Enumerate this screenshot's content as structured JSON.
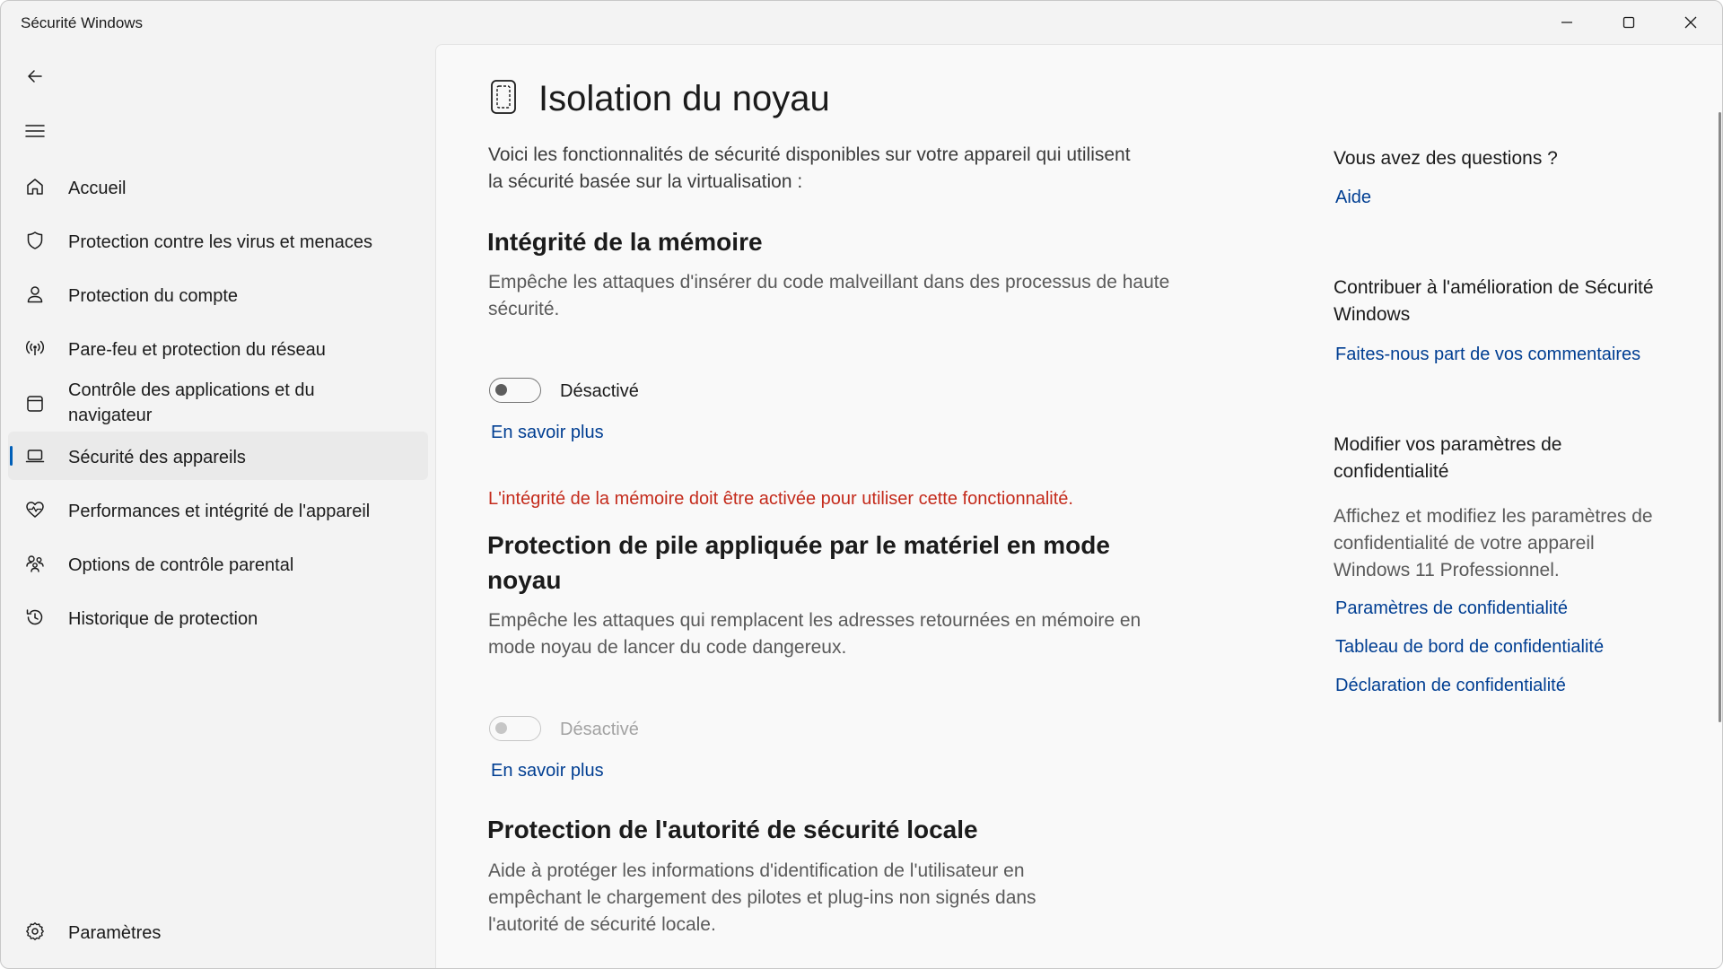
{
  "window": {
    "title": "Sécurité Windows"
  },
  "sidebar": {
    "items": [
      {
        "label": "Accueil",
        "icon": "home-icon"
      },
      {
        "label": "Protection contre les virus et menaces",
        "icon": "shield-icon"
      },
      {
        "label": "Protection du compte",
        "icon": "person-icon"
      },
      {
        "label": "Pare-feu et protection du réseau",
        "icon": "wifi-antenna-icon"
      },
      {
        "label": "Contrôle des applications et du navigateur",
        "icon": "app-window-icon"
      },
      {
        "label": "Sécurité des appareils",
        "icon": "laptop-icon",
        "active": true
      },
      {
        "label": "Performances et intégrité de l'appareil",
        "icon": "heart-pulse-icon"
      },
      {
        "label": "Options de contrôle parental",
        "icon": "family-icon"
      },
      {
        "label": "Historique de protection",
        "icon": "history-icon"
      }
    ],
    "settings_label": "Paramètres"
  },
  "main": {
    "title": "Isolation du noyau",
    "intro": "Voici les fonctionnalités de sécurité disponibles sur votre appareil qui utilisent la sécurité basée sur la virtualisation :",
    "sections": [
      {
        "title": "Intégrité de la mémoire",
        "description": "Empêche les attaques d'insérer du code malveillant dans des processus de haute sécurité.",
        "toggle_state": "Désactivé",
        "toggle_on": false,
        "toggle_enabled": true,
        "link": "En savoir plus"
      },
      {
        "warning": "L'intégrité de la mémoire doit être activée pour utiliser cette fonctionnalité.",
        "title": "Protection de pile appliquée par le matériel en mode noyau",
        "description": "Empêche les attaques qui remplacent les adresses retournées en mémoire en mode noyau de lancer du code dangereux.",
        "toggle_state": "Désactivé",
        "toggle_on": false,
        "toggle_enabled": false,
        "link": "En savoir plus"
      },
      {
        "title": "Protection de l'autorité de sécurité locale",
        "description": "Aide à protéger les informations d'identification de l'utilisateur en empêchant le chargement des pilotes et plug-ins non signés dans l'autorité de sécurité locale."
      }
    ]
  },
  "right_panel": {
    "questions": {
      "heading": "Vous avez des questions ?",
      "link": "Aide"
    },
    "feedback": {
      "heading": "Contribuer à l'amélioration de Sécurité Windows",
      "link": "Faites-nous part de vos commentaires"
    },
    "privacy": {
      "heading": "Modifier vos paramètres de confidentialité",
      "text": "Affichez et modifiez les paramètres de confidentialité de votre appareil Windows 11 Professionnel.",
      "links": [
        "Paramètres de confidentialité",
        "Tableau de bord de confidentialité",
        "Déclaration de confidentialité"
      ]
    }
  },
  "colors": {
    "accent": "#005fb8",
    "link": "#003e92",
    "warning": "#c42b1c"
  }
}
